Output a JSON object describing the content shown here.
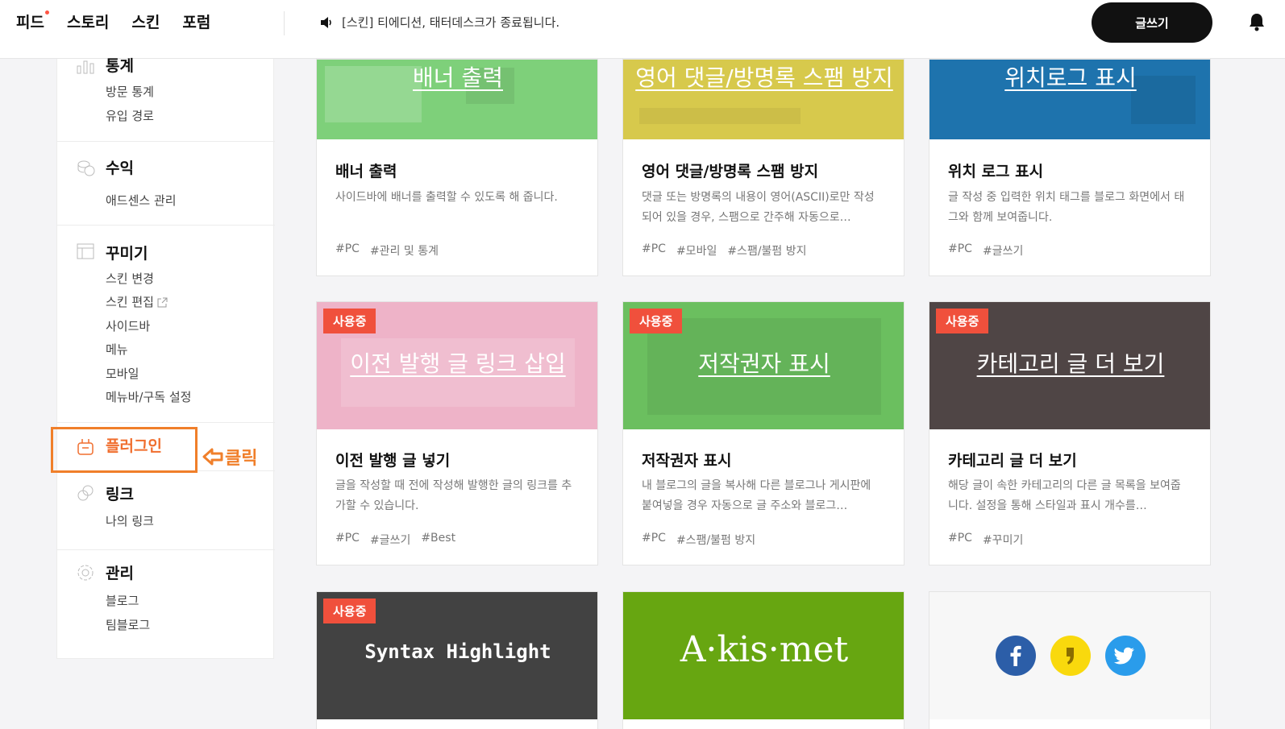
{
  "topbar": {
    "nav": [
      "피드",
      "스토리",
      "스킨",
      "포럼"
    ],
    "notice": "[스킨] 티에디션, 태터데스크가 종료됩니다.",
    "write_button": "글쓰기"
  },
  "sidebar": {
    "stats": {
      "title": "통계",
      "items": [
        "방문 통계",
        "유입 경로"
      ]
    },
    "revenue": {
      "title": "수익",
      "items": [
        "애드센스 관리"
      ]
    },
    "design": {
      "title": "꾸미기",
      "items": [
        "스킨 변경",
        "스킨 편집",
        "사이드바",
        "메뉴",
        "모바일",
        "메뉴바/구독 설정"
      ]
    },
    "plugin": {
      "title": "플러그인"
    },
    "link": {
      "title": "링크",
      "items": [
        "나의 링크"
      ]
    },
    "manage": {
      "title": "관리",
      "items": [
        "블로그",
        "팀블로그"
      ]
    }
  },
  "annotation": {
    "label": "클릭",
    "color": "#f07f2a"
  },
  "plugins": [
    {
      "thumb_title": "배너 출력",
      "color": "#7ed07a",
      "title": "배너 출력",
      "desc": "사이드바에 배너를 출력할 수 있도록 해 줍니다.",
      "tags": [
        "#PC",
        "#관리 및 통계"
      ]
    },
    {
      "thumb_title": "영어 댓글/방명록 스팸 방지",
      "color": "#d7c94c",
      "title": "영어 댓글/방명록 스팸 방지",
      "desc": "댓글 또는 방명록의 내용이 영어(ASCII)로만 작성되어 있을 경우, 스팸으로 간주해 자동으로…",
      "tags": [
        "#PC",
        "#모바일",
        "#스팸/불펌 방지"
      ]
    },
    {
      "thumb_title": "위치로그 표시",
      "color": "#1e73ad",
      "title": "위치 로그 표시",
      "desc": "글 작성 중 입력한 위치 태그를 블로그 화면에서 태그와 함께 보여줍니다.",
      "tags": [
        "#PC",
        "#글쓰기"
      ]
    },
    {
      "badge": "사용중",
      "thumb_title": "이전 발행 글 링크 삽입",
      "color": "#eeb3c8",
      "title": "이전 발행 글 넣기",
      "desc": "글을 작성할 때 전에 작성해 발행한 글의 링크를 추가할 수 있습니다.",
      "tags": [
        "#PC",
        "#글쓰기",
        "#Best"
      ]
    },
    {
      "badge": "사용중",
      "thumb_title": "저작권자 표시",
      "color": "#6bbf5f",
      "title": "저작권자 표시",
      "desc": "내 블로그의 글을 복사해 다른 블로그나 게시판에 붙여넣을 경우 자동으로 글 주소와 블로그…",
      "tags": [
        "#PC",
        "#스팸/불펌 방지"
      ]
    },
    {
      "badge": "사용중",
      "thumb_title": "카테고리 글 더 보기",
      "color": "#4f4545",
      "title": "카테고리 글 더 보기",
      "desc": "해당 글이 속한 카테고리의 다른 글 목록을 보여줍니다. 설정을 통해 스타일과 표시 개수를…",
      "tags": [
        "#PC",
        "#꾸미기"
      ]
    },
    {
      "badge": "사용중",
      "thumb_title": "Syntax Highlight",
      "color": "#424242"
    },
    {
      "thumb_title": "A·kis·met",
      "color": "#67a611"
    },
    {
      "color": "#f7f7f7",
      "social": [
        "facebook-icon",
        "kakaostory-icon",
        "twitter-icon"
      ]
    }
  ]
}
